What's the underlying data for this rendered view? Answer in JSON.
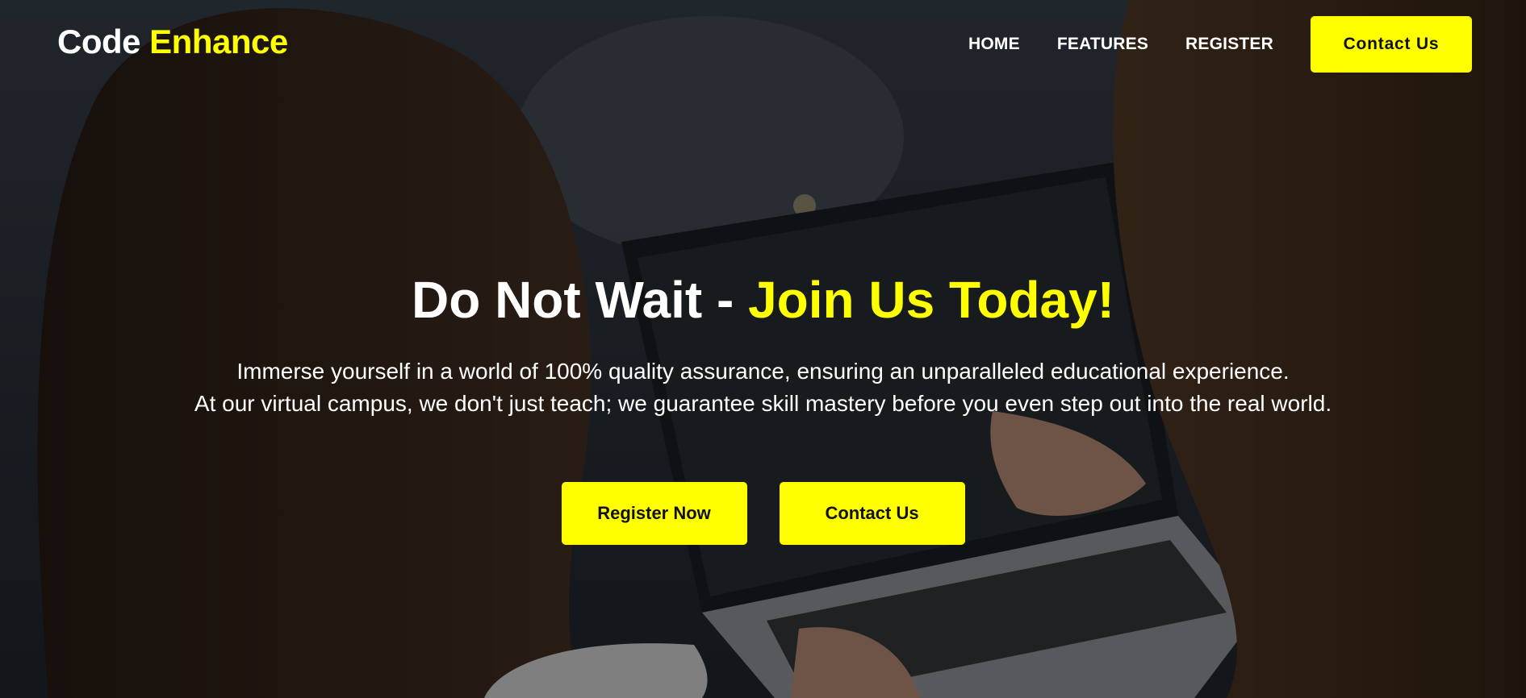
{
  "brand": {
    "name_part1": "Code",
    "name_part2": "Enhance"
  },
  "nav": {
    "items": [
      {
        "label": "HOME"
      },
      {
        "label": "FEATURES"
      },
      {
        "label": "REGISTER"
      }
    ],
    "cta_label": "Contact Us"
  },
  "hero": {
    "headline_part1": "Do Not Wait -",
    "headline_part2": "Join Us Today!",
    "sub_line1": "Immerse yourself in a world of 100% quality assurance, ensuring an unparalleled educational experience.",
    "sub_line2": "At our virtual campus, we don't just teach; we guarantee skill mastery before you even step out into the real world.",
    "register_label": "Register Now",
    "contact_label": "Contact Us"
  },
  "colors": {
    "accent": "#ffff00",
    "text": "#ffffff",
    "button_text": "#111111"
  }
}
